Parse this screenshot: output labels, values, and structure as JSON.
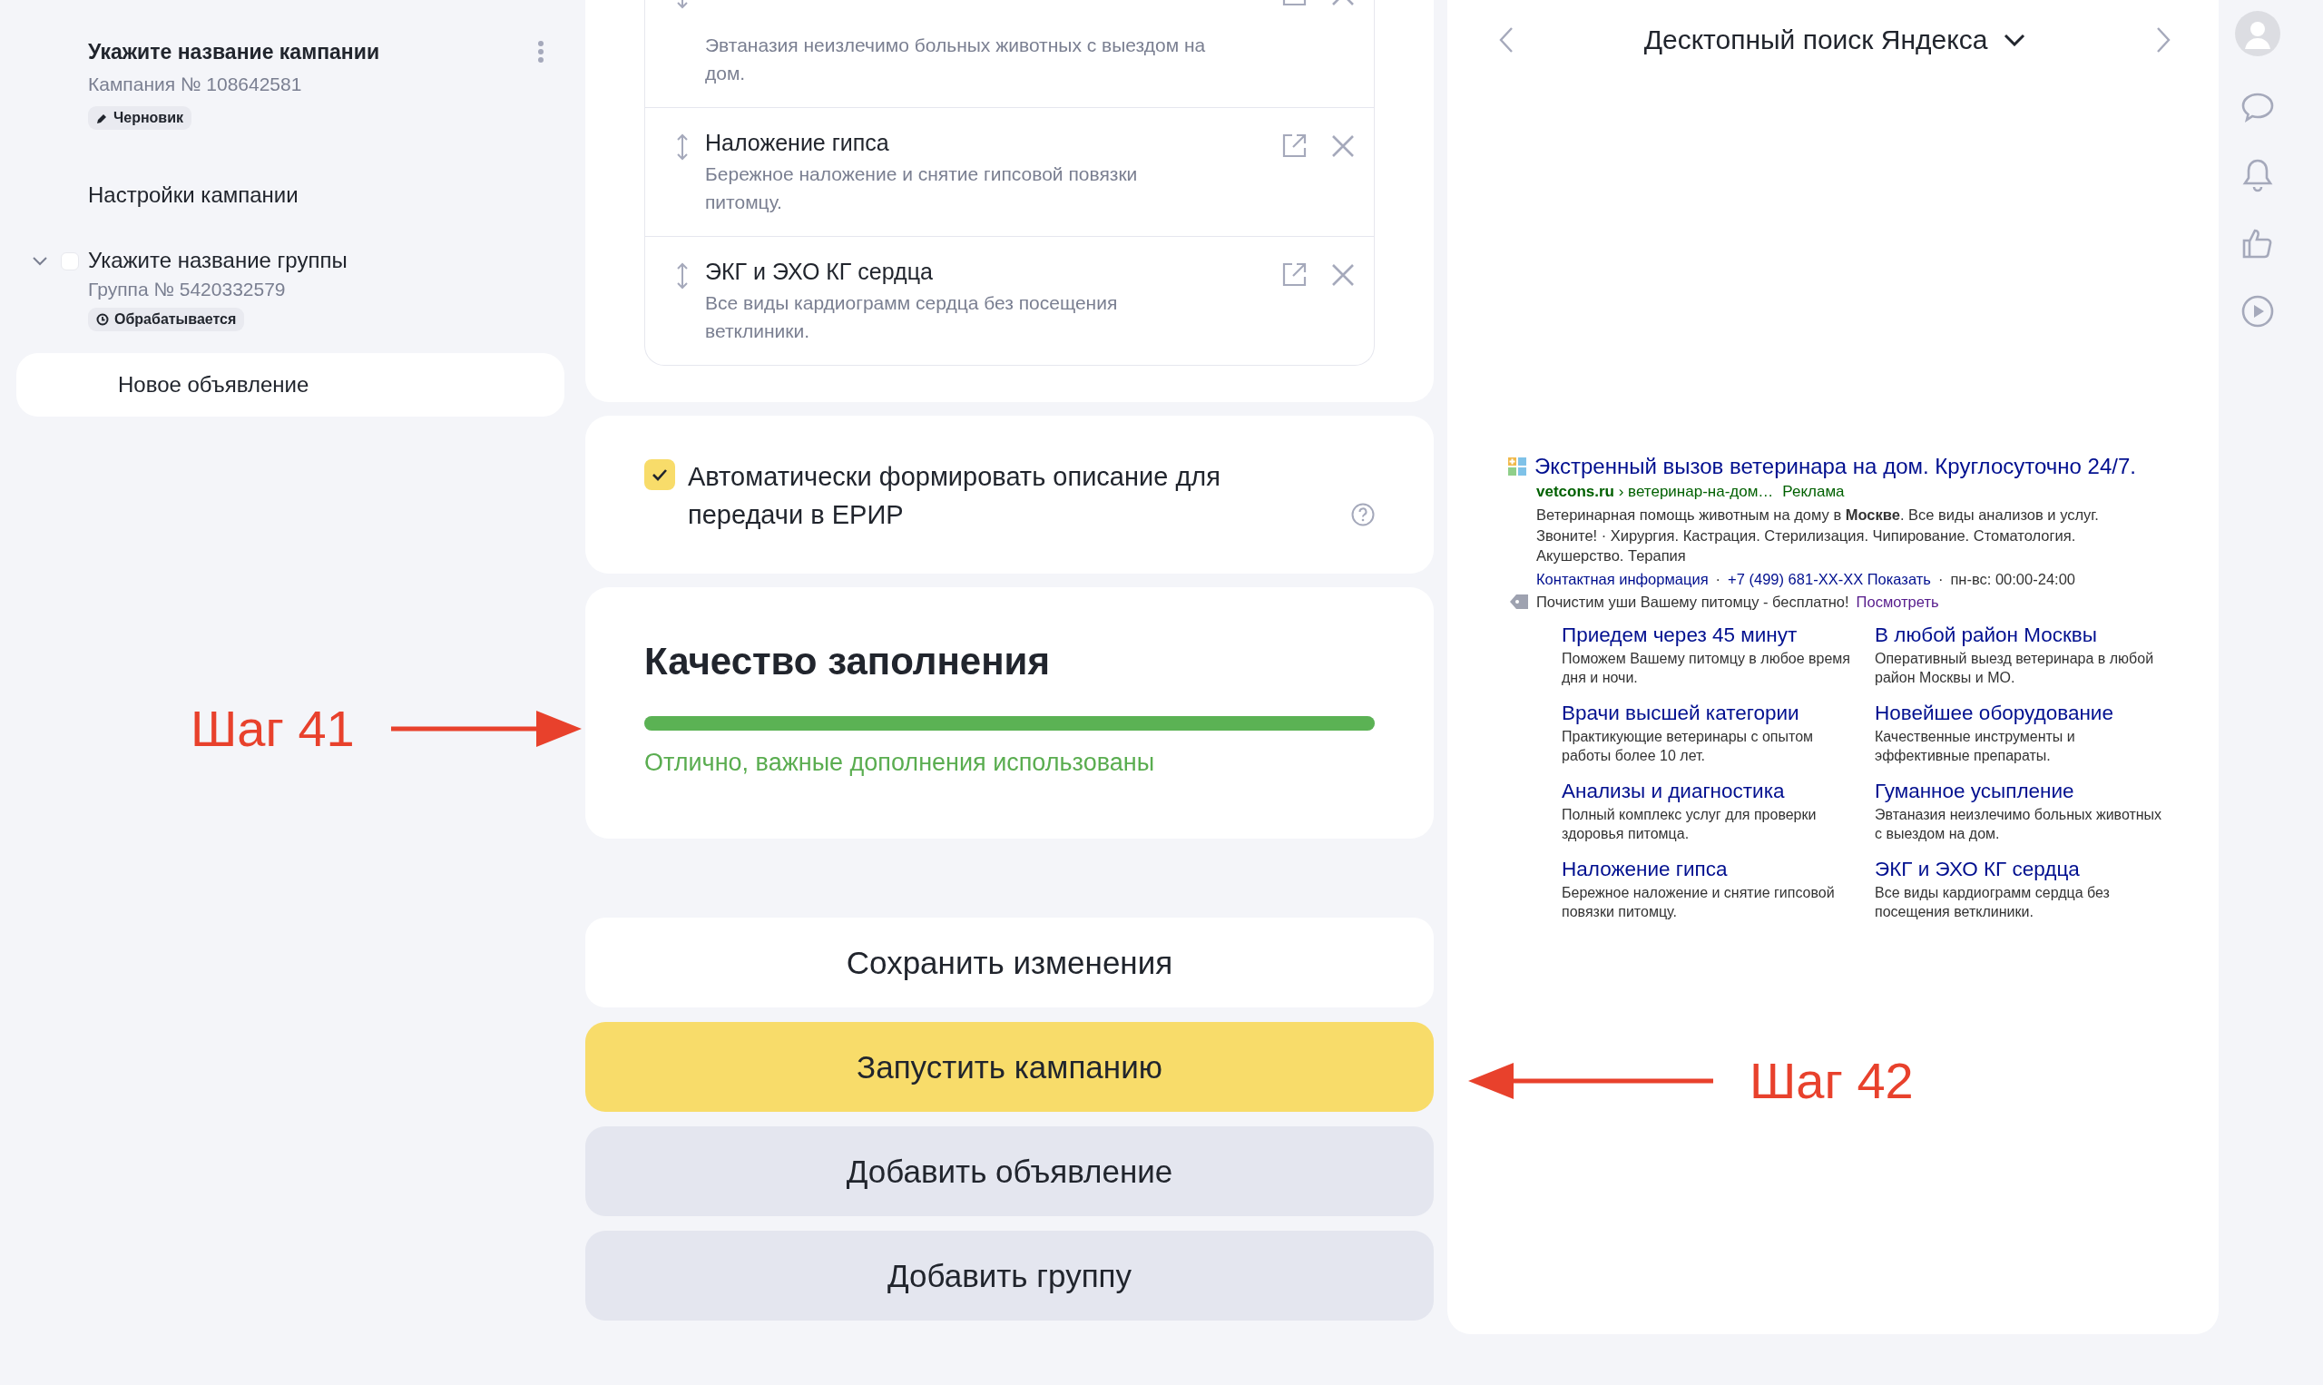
{
  "sidebar": {
    "campaign": {
      "title": "Укажите название кампании",
      "number": "Кампания № 108642581",
      "status": "Черновик"
    },
    "settings_link": "Настройки кампании",
    "group": {
      "title": "Укажите название группы",
      "number": "Группа № 5420332579",
      "status": "Обрабатывается",
      "expanded": true,
      "checked": false
    },
    "ad": {
      "title": "Новое объявление",
      "selected": true
    }
  },
  "sitelinks": [
    {
      "description": "Эвтаназия неизлечимо больных животных с выездом на дом."
    },
    {
      "title": "Наложение гипса",
      "description": "Бережное наложение и снятие гипсовой повязки питомцу."
    },
    {
      "title": "ЭКГ и ЭХО КГ сердца",
      "description": "Все виды кардиограмм сердца без посещения ветклиники."
    }
  ],
  "auto_description": {
    "label": "Автоматически формировать описание для передачи в ЕРИР",
    "checked": true
  },
  "quality": {
    "title": "Качество заполнения",
    "level": 1,
    "message": "Отлично, важные дополнения использованы"
  },
  "buttons": [
    {
      "label": "Сохранить изменения",
      "kind": "secondary"
    },
    {
      "label": "Запустить кампанию",
      "kind": "primary"
    },
    {
      "label": "Добавить объявление",
      "kind": "muted"
    },
    {
      "label": "Добавить группу",
      "kind": "muted"
    }
  ],
  "annotations": [
    {
      "label": "Шаг 41",
      "kind": "right-arrow"
    },
    {
      "label": "Шаг 42",
      "kind": "left-arrow"
    }
  ],
  "preview": {
    "title": "Десктопный поиск Яндекса",
    "ad": {
      "title": "Экстренный вызов ветеринара на дом. Круглосуточно 24/7.",
      "domain": "vetcons.ru",
      "path": "› ветеринар-на-дом…",
      "label": "Реклама",
      "text": "Ветеринарная помощь животным на дому в **Москве**. Все виды анализов и услуг. Звоните! · Хирургия. Кастрация. Стерилизация. Чипирование. Стоматология. Акушерство. Терапия",
      "contacts": [
        "Контактная информация",
        "·",
        "+7 (499) 681-XX-XX Показать",
        "·",
        "пн-вс: 00:00-24:00"
      ],
      "promo": {
        "text": "Почистим уши Вашему питомцу - бесплатно!",
        "link": "Посмотреть"
      },
      "sitelinks": [
        {
          "title": "Приедем через 45 минут",
          "description": "Поможем Вашему питомцу в любое время дня и ночи."
        },
        {
          "title": "В любой район Москвы",
          "description": "Оперативный выезд ветеринара в любой район Москвы и МО."
        },
        {
          "title": "Врачи высшей категории",
          "description": "Практикующие ветеринары с опытом работы более 10 лет."
        },
        {
          "title": "Новейшее оборудование",
          "description": "Качественные инструменты и эффективные препараты."
        },
        {
          "title": "Анализы и диагностика",
          "description": "Полный комплекс услуг для проверки здоровья питомца."
        },
        {
          "title": "Гуманное усыпление",
          "description": "Эвтаназия неизлечимо больных животных с выездом на дом."
        },
        {
          "title": "Наложение гипса",
          "description": "Бережное наложение и снятие гипсовой повязки питомцу."
        },
        {
          "title": "ЭКГ и ЭХО КГ сердца",
          "description": "Все виды кардиограмм сердца без посещения ветклиники."
        }
      ]
    }
  }
}
